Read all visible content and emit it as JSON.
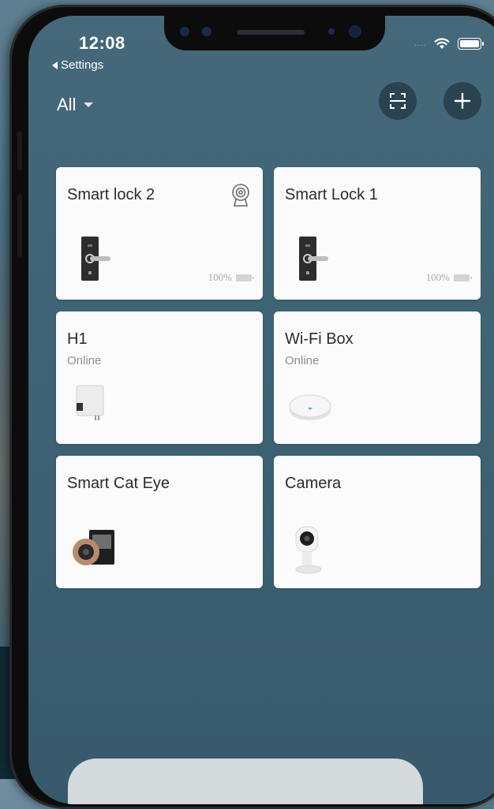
{
  "status_bar": {
    "time": "12:08",
    "back_label": "Settings",
    "signal": "...."
  },
  "header": {
    "filter_label": "All",
    "scan_icon": "scan-icon",
    "add_icon": "plus-icon"
  },
  "devices": [
    {
      "name": "Smart lock 2",
      "status": "",
      "battery": "100%",
      "icon": "door-lock-icon",
      "extra_icon": "camera-lens-icon"
    },
    {
      "name": "Smart Lock 1",
      "status": "",
      "battery": "100%",
      "icon": "door-lock-icon"
    },
    {
      "name": "H1",
      "status": "Online",
      "icon": "hub-plug-icon"
    },
    {
      "name": "Wi-Fi Box",
      "status": "Online",
      "icon": "wifi-box-icon"
    },
    {
      "name": "Smart Cat Eye",
      "status": "",
      "icon": "peephole-camera-icon"
    },
    {
      "name": "Camera",
      "status": "",
      "icon": "security-camera-icon"
    }
  ],
  "colors": {
    "screen_bg": "#3e6375",
    "card_bg": "#fbfbfb",
    "text_dark": "#2b2b2b",
    "text_muted": "#8d8d8d"
  }
}
